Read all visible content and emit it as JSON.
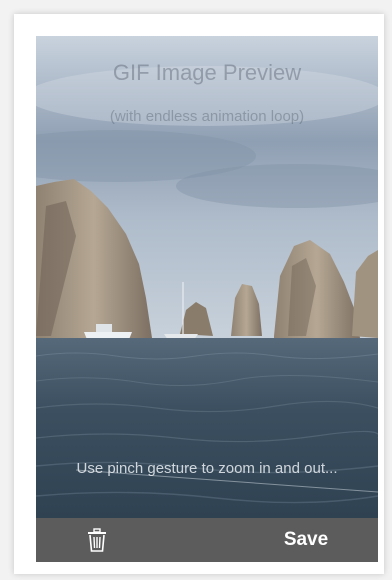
{
  "preview": {
    "title": "GIF Image Preview",
    "subtitle": "(with endless animation loop)",
    "hint": "Use pinch gesture to zoom in and out..."
  },
  "toolbar": {
    "delete_icon": "trash-icon",
    "save_label": "Save"
  },
  "colors": {
    "toolbar_bg": "#5c5c5c",
    "sky": "#aab7c6",
    "sea": "#3d5364"
  }
}
